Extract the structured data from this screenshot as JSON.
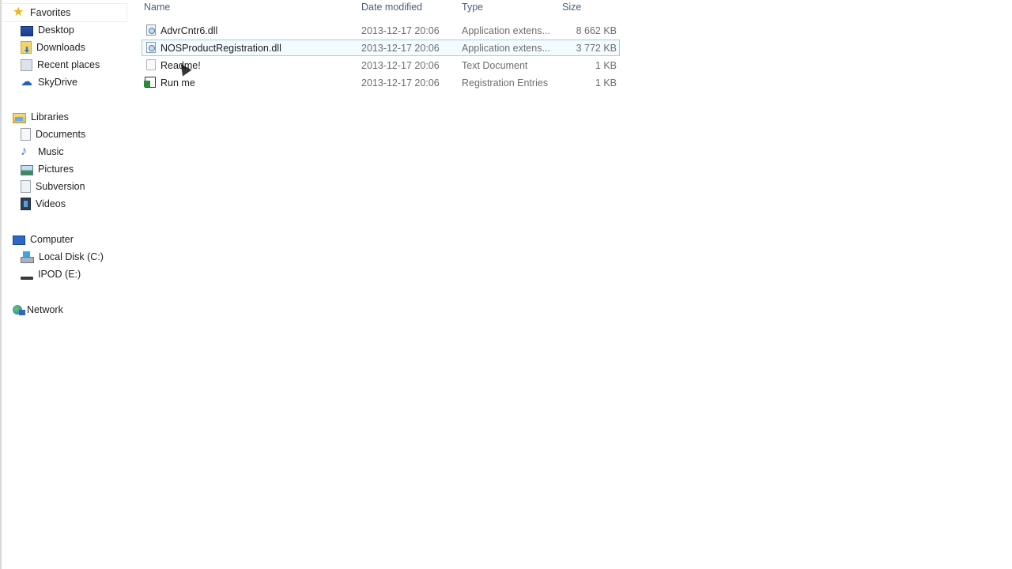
{
  "navigation": {
    "favorites": {
      "label": "Favorites",
      "items": [
        {
          "label": "Desktop",
          "icon": "desktop-icon"
        },
        {
          "label": "Downloads",
          "icon": "downloads-icon"
        },
        {
          "label": "Recent places",
          "icon": "recent-places-icon"
        },
        {
          "label": "SkyDrive",
          "icon": "skydrive-icon"
        }
      ]
    },
    "libraries": {
      "label": "Libraries",
      "items": [
        {
          "label": "Documents",
          "icon": "documents-icon"
        },
        {
          "label": "Music",
          "icon": "music-icon"
        },
        {
          "label": "Pictures",
          "icon": "pictures-icon"
        },
        {
          "label": "Subversion",
          "icon": "subversion-icon"
        },
        {
          "label": "Videos",
          "icon": "videos-icon"
        }
      ]
    },
    "computer": {
      "label": "Computer",
      "items": [
        {
          "label": "Local Disk (C:)",
          "icon": "local-disk-icon"
        },
        {
          "label": "IPOD (E:)",
          "icon": "removable-drive-icon"
        }
      ]
    },
    "network": {
      "label": "Network"
    }
  },
  "file_list": {
    "columns": {
      "name": "Name",
      "date": "Date modified",
      "type": "Type",
      "size": "Size"
    },
    "rows": [
      {
        "name": "AdvrCntr6.dll",
        "date": "2013-12-17 20:06",
        "type": "Application extens...",
        "size": "8 662 KB",
        "icon": "dll-file-icon",
        "selected": false
      },
      {
        "name": "NOSProductRegistration.dll",
        "date": "2013-12-17 20:06",
        "type": "Application extens...",
        "size": "3 772 KB",
        "icon": "dll-file-icon",
        "selected": true
      },
      {
        "name": "Readme!",
        "date": "2013-12-17 20:06",
        "type": "Text Document",
        "size": "1 KB",
        "icon": "text-file-icon",
        "selected": false
      },
      {
        "name": "Run me",
        "date": "2013-12-17 20:06",
        "type": "Registration Entries",
        "size": "1 KB",
        "icon": "registry-file-icon",
        "selected": false
      }
    ]
  }
}
